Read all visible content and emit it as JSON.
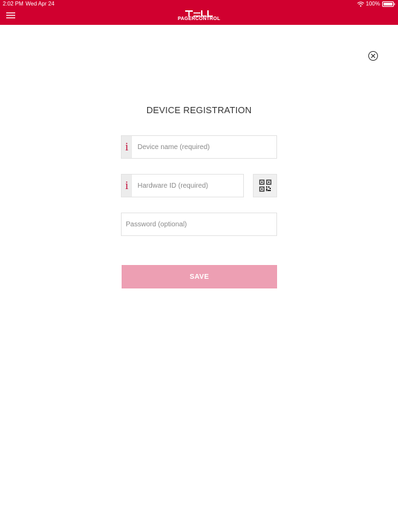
{
  "status_bar": {
    "time": "2:02 PM",
    "date": "Wed Apr 24",
    "battery": "100%"
  },
  "header": {
    "logo_main": "TELL",
    "logo_sub": "PAGERCONTROL",
    "background_color": "#d0002f"
  },
  "form": {
    "title": "DEVICE REGISTRATION",
    "device_name": {
      "value": "",
      "placeholder": "Device name (required)"
    },
    "hardware_id": {
      "value": "",
      "placeholder": "Hardware ID (required)"
    },
    "password": {
      "value": "",
      "placeholder": "Password (optional)"
    },
    "info_icon": "i",
    "qr_icon": "qr-code-icon",
    "save_label": "SAVE",
    "save_color": "#ed9fb3"
  }
}
